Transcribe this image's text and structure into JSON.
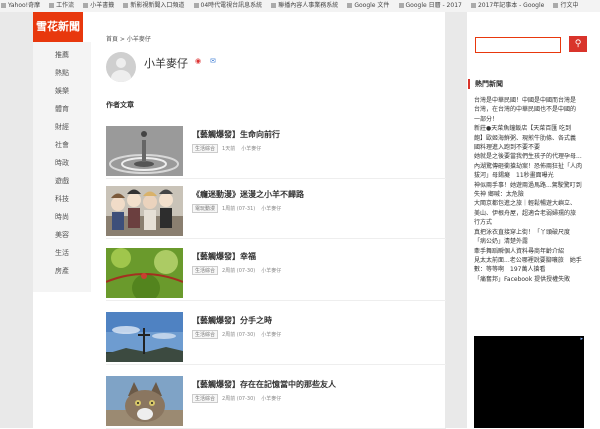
{
  "bookmarks": [
    "Yahoo!奇摩",
    "工作流",
    "小羊書籤",
    "新影視新聞入口頻道",
    "04時代電視台訊息系統",
    "聯播內容人事業務系統",
    "Google 文件",
    "Google 日曆 - 2017",
    "2017年記事本 - Google",
    "行文中"
  ],
  "site": {
    "logo": "雪花新聞"
  },
  "nav": {
    "items": [
      "推薦",
      "熱點",
      "娛樂",
      "體育",
      "財經",
      "社會",
      "時政",
      "遊戲",
      "科技",
      "時尚",
      "美容",
      "生活",
      "房產"
    ]
  },
  "breadcrumb": "首頁 > 小羊麥仔",
  "author": {
    "name": "小羊麥仔"
  },
  "section_title": "作者文章",
  "articles": [
    {
      "title": "【藝觸爆發】生命向前行",
      "tag": "生活綜合",
      "time": "1天前",
      "author": "小羊麥仔"
    },
    {
      "title": "《癮迷動漫》迷漫之小羊不歸路",
      "tag": "電玩動漫",
      "time": "1周前 (07-31)",
      "author": "小羊麥仔"
    },
    {
      "title": "【藝觸爆發】幸福",
      "tag": "生活綜合",
      "time": "2周前 (07-30)",
      "author": "小羊麥仔"
    },
    {
      "title": "【藝觸爆發】分手之時",
      "tag": "生活綜合",
      "time": "2周前 (07-30)",
      "author": "小羊麥仔"
    },
    {
      "title": "【藝觸爆發】存在在記憶當中的那些友人",
      "tag": "生活綜合",
      "time": "2周前 (07-30)",
      "author": "小羊麥仔"
    }
  ],
  "sidebar": {
    "hot_title": "熱門新聞",
    "hot_lines": [
      "台灣是中華民國！中國是中國而台灣是",
      "台灣，在台灣的中華民國也不是中國的",
      "一部分！",
      "新莊●天菜魚鐘飯店【天菜百匯 吃到",
      "飽】歐姬海鮮粥、現煎牛肋條、各式義",
      "國料理進入跑到不要不要",
      "她就是之後要當我們生孩子的代理孕母...",
      "內湖驚傳砸衝搶劫案！恐佈兩狂扯「人肉",
      "拔河」母錫癡　11秒畫面曝光",
      "神似兩手事！她遊兩過馬路...駕駛驚叮到",
      "失神 鄉喊：太危險",
      "大閩京都包進之旅｜輕鬆暢遊大嶼立、",
      "美山、伊根舟屋，超適合老弱婦孺的旅",
      "行方式",
      "真把泳衣直接穿上街！「丫頭破尺度",
      "「病公奶」清楚外露",
      "牽手舞蹈瞬個人資料尋商年齡介紹",
      "見太太前面...老公哪裡說要腳嚷旅　她手",
      "數：等等啊　197萬人搶看",
      "「痛奮邦」Facebook 提供授權失敗"
    ]
  },
  "colors": {
    "brand": "#e8380d",
    "accent": "#d9342b"
  },
  "icons": {
    "search": "search-icon",
    "weibo": "weibo-icon",
    "mail": "mail-icon"
  }
}
